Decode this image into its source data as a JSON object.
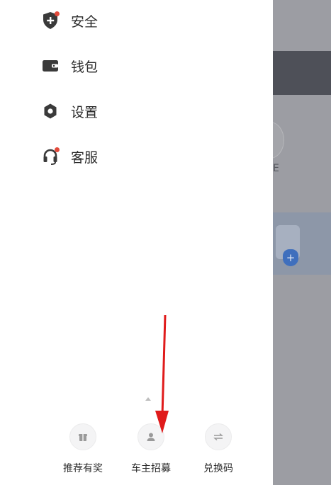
{
  "drawer": {
    "menu": [
      {
        "label": "安全",
        "icon": "security-shield-icon"
      },
      {
        "label": "钱包",
        "icon": "wallet-icon"
      },
      {
        "label": "设置",
        "icon": "gear-icon"
      },
      {
        "label": "客服",
        "icon": "headset-icon"
      }
    ],
    "shortcuts": [
      {
        "label": "推荐有奖",
        "icon": "gift-icon"
      },
      {
        "label": "车主招募",
        "icon": "driver-icon"
      },
      {
        "label": "兑换码",
        "icon": "exchange-icon"
      }
    ]
  },
  "background": {
    "partial_text": "E"
  },
  "colors": {
    "accent_red": "#e24a3b",
    "icon_dark": "#3a3a3a",
    "arrow_red": "#e01b1b"
  }
}
